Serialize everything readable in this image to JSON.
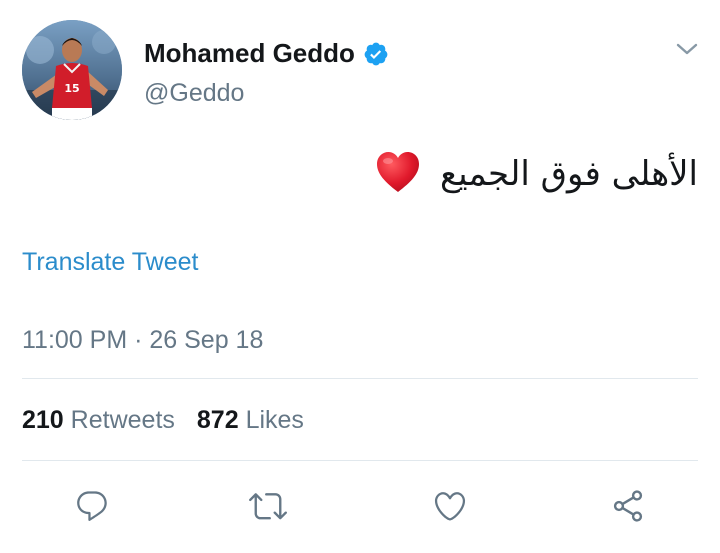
{
  "tweet": {
    "author": {
      "display_name": "Mohamed Geddo",
      "handle": "@Geddo",
      "verified": true,
      "jersey_number": "15"
    },
    "text": "الأهلى فوق الجميع",
    "emoji": "red-heart",
    "translate_label": "Translate Tweet",
    "timestamp": "11:00 PM · 26 Sep 18",
    "stats": {
      "retweets_count": "210",
      "retweets_label": "Retweets",
      "likes_count": "872",
      "likes_label": "Likes"
    },
    "actions": [
      "reply-icon",
      "retweet-icon",
      "like-icon",
      "share-icon"
    ]
  },
  "colors": {
    "link": "#2b8ccb",
    "muted": "#657786",
    "verified": "#1da1f2",
    "divider": "#e1e8ed",
    "heart": "#e0192b"
  }
}
